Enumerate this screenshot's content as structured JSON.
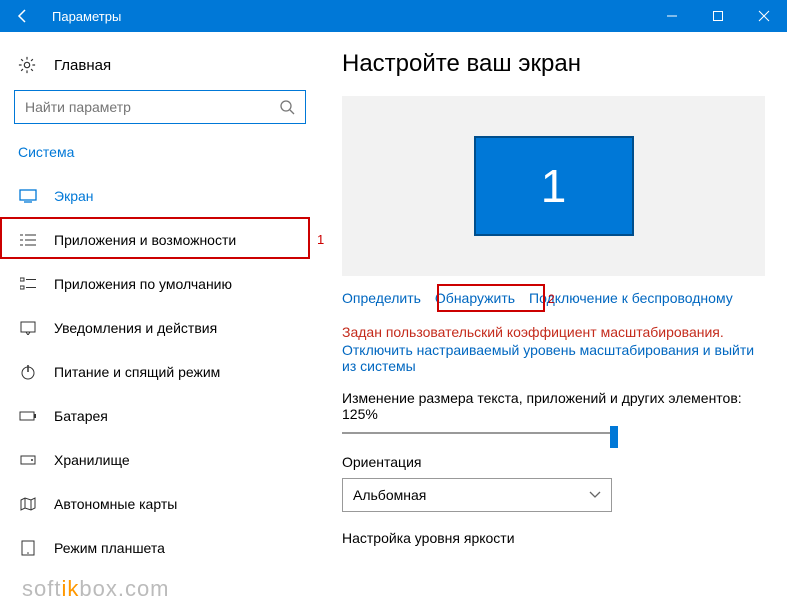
{
  "titlebar": {
    "title": "Параметры"
  },
  "sidebar": {
    "home": "Главная",
    "search_placeholder": "Найти параметр",
    "category": "Система",
    "items": [
      {
        "label": "Экран"
      },
      {
        "label": "Приложения и возможности"
      },
      {
        "label": "Приложения по умолчанию"
      },
      {
        "label": "Уведомления и действия"
      },
      {
        "label": "Питание и спящий режим"
      },
      {
        "label": "Батарея"
      },
      {
        "label": "Хранилище"
      },
      {
        "label": "Автономные карты"
      },
      {
        "label": "Режим планшета"
      }
    ]
  },
  "annotations": {
    "num1": "1",
    "num2": "2"
  },
  "content": {
    "heading": "Настройте ваш экран",
    "display_number": "1",
    "links": {
      "identify": "Определить",
      "detect": "Обнаружить",
      "wireless": "Подключение к беспроводному"
    },
    "warning": "Задан пользовательский коэффициент масштабирования.",
    "disable_link": "Отключить настраиваемый уровень масштабирования и выйти из системы",
    "scale_label": "Изменение размера текста, приложений и других элементов: 125%",
    "orientation_label": "Ориентация",
    "orientation_value": "Альбомная",
    "brightness_label": "Настройка уровня яркости"
  },
  "watermark": {
    "a": "soft",
    "b": "ik",
    "c": "box.com"
  }
}
